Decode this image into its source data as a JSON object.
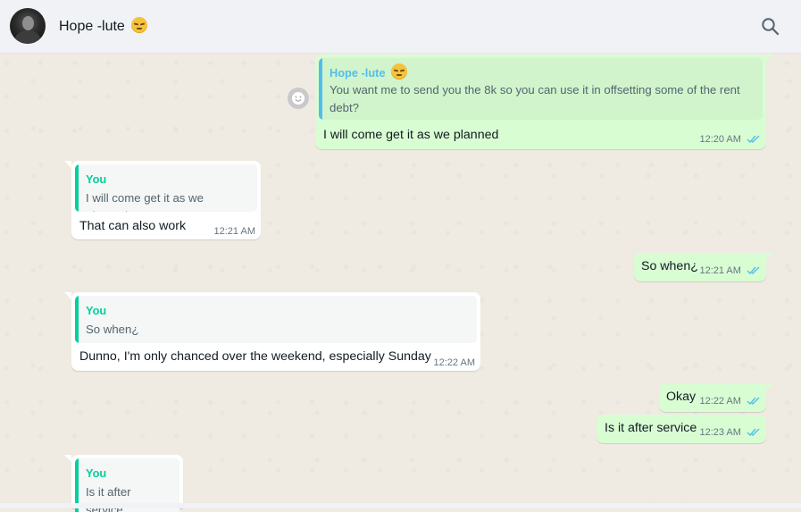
{
  "header": {
    "contact_name": "Hope -lute",
    "contact_emoji": "pensive-face-emoji"
  },
  "colors": {
    "outgoing_bubble": "#d9fdd3",
    "incoming_bubble": "#ffffff",
    "read_ticks": "#53bdeb",
    "quote_self": "#06cf9c",
    "quote_contact": "#53bdeb"
  },
  "messages": [
    {
      "direction": "outgoing",
      "quote_author": "Hope -lute",
      "quote_text": "You want me to send you the 8k so you can use it in offsetting some of the rent debt?",
      "text": "I will come get it as we planned",
      "time": "12:20 AM",
      "status": "read"
    },
    {
      "direction": "incoming",
      "quote_author": "You",
      "quote_text": "I will come get it as we planned",
      "text": "That can also work",
      "time": "12:21 AM"
    },
    {
      "direction": "outgoing",
      "text": "So when¿",
      "time": "12:21 AM",
      "status": "read"
    },
    {
      "direction": "incoming",
      "quote_author": "You",
      "quote_text": "So when¿",
      "text": "Dunno, I'm only chanced over the weekend, especially Sunday",
      "time": "12:22 AM"
    },
    {
      "direction": "outgoing",
      "text": "Okay",
      "time": "12:22 AM",
      "status": "read"
    },
    {
      "direction": "outgoing",
      "text": "Is it after service",
      "time": "12:23 AM",
      "status": "read"
    },
    {
      "direction": "incoming",
      "quote_author": "You",
      "quote_text": "Is it after service",
      "text": "",
      "time": ""
    }
  ]
}
